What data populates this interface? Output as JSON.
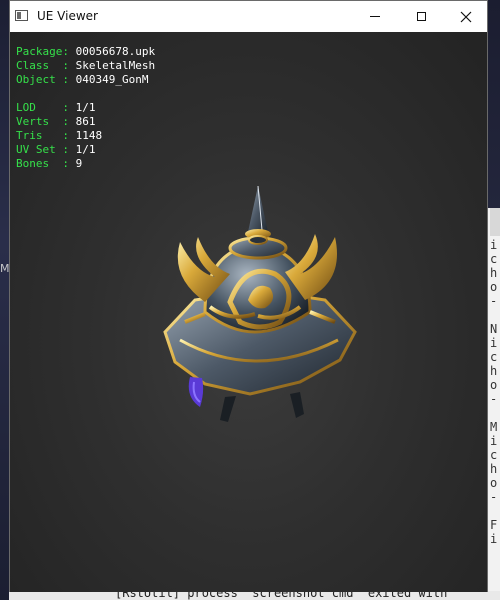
{
  "window": {
    "title": "UE Viewer"
  },
  "titlebar": {
    "minimize_icon": "minimize-icon",
    "maximize_icon": "maximize-icon",
    "close_icon": "close-icon"
  },
  "info": {
    "package": {
      "label": "Package: ",
      "value": "00056678.upk"
    },
    "class": {
      "label": "Class  : ",
      "value": "SkeletalMesh"
    },
    "object": {
      "label": "Object : ",
      "value": "040349_GonM"
    },
    "lod": {
      "label": "LOD    : ",
      "value": "1/1"
    },
    "verts": {
      "label": "Verts  : ",
      "value": "861"
    },
    "tris": {
      "label": "Tris   : ",
      "value": "1148"
    },
    "uvset": {
      "label": "UV Set : ",
      "value": "1/1"
    },
    "bones": {
      "label": "Bones  : ",
      "value": "9"
    }
  },
  "colors": {
    "label_green": "#35e04a",
    "value_white": "#ffffff",
    "viewport_bg": "#2f2f2f",
    "gold": "#d4a53a"
  },
  "background": {
    "right_panel_text": "i\nc\nh\no\n-\n\nN\ni\nc\nh\no\n-\n\nM\ni\nc\nh\no\n-\n\nF\ni",
    "left_glyph": "M",
    "bottom_text": "[RstUtil] process \"screenshot cmd\" exited with"
  }
}
